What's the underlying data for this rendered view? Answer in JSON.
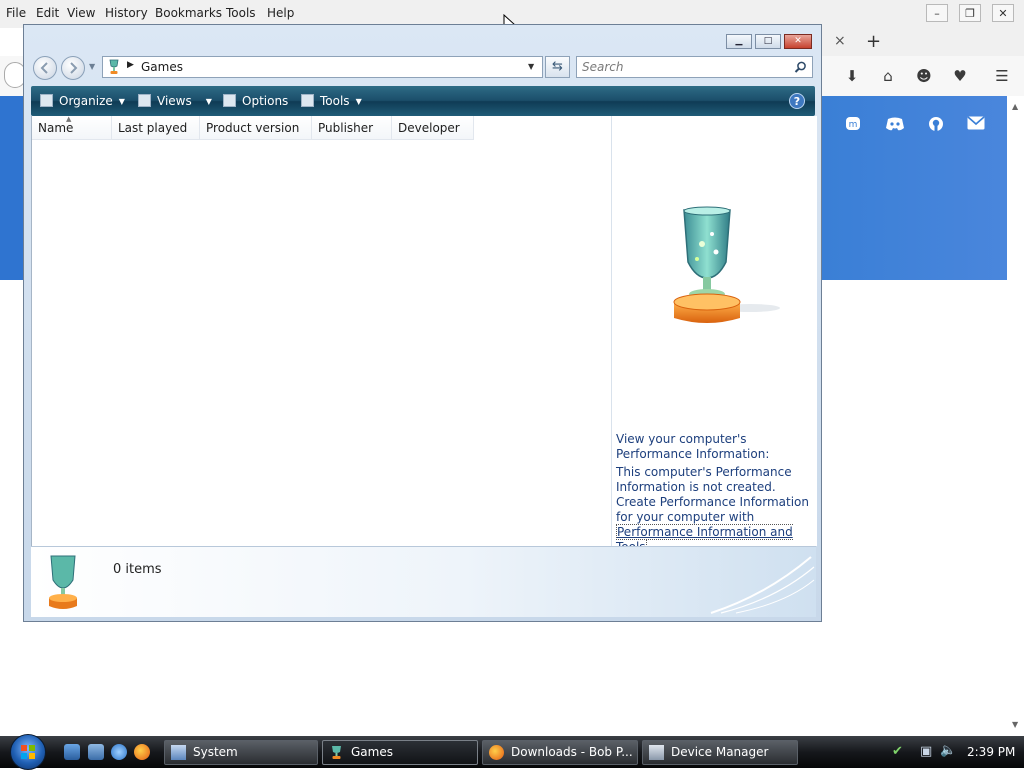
{
  "browser": {
    "menu": [
      "File",
      "Edit",
      "View",
      "History",
      "Bookmarks",
      "Tools",
      "Help"
    ],
    "new_tab": "+",
    "close_tab": "×"
  },
  "explorer": {
    "address": "Games",
    "search_placeholder": "Search",
    "commands": {
      "organize": "Organize",
      "views": "Views",
      "options": "Options",
      "tools": "Tools"
    },
    "help": "?",
    "columns": [
      "Name",
      "Last played",
      "Product version",
      "Publisher",
      "Developer"
    ],
    "info": {
      "view_link": "View your computer's Performance Information:",
      "status_text": "This computer's Performance Information is not created.",
      "create_prefix": "Create Performance Information for your computer with",
      "create_link": "Performance Information and Tools",
      "create_suffix": "."
    },
    "details": {
      "item_count": "0 items"
    }
  },
  "taskbar": {
    "buttons": [
      {
        "label": "System"
      },
      {
        "label": "Games"
      },
      {
        "label": "Downloads - Bob P..."
      },
      {
        "label": "Device Manager"
      }
    ],
    "clock": "2:39 PM"
  },
  "colors": {
    "vista_cmdbar": "#1b4e6a",
    "link_blue": "#1d3f7d",
    "firefox_blue": "#3a7fd6"
  }
}
